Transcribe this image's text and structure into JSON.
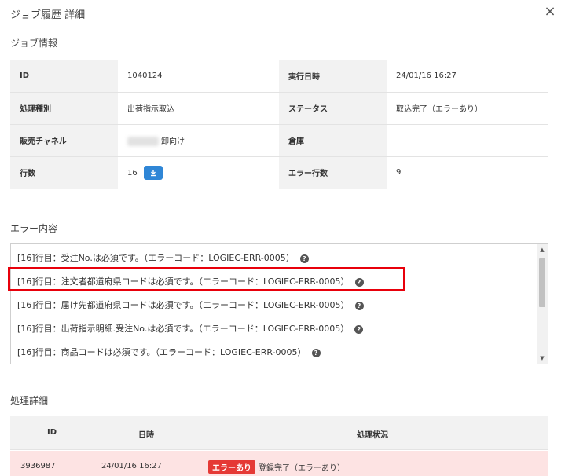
{
  "modal": {
    "title": "ジョブ履歴 詳細",
    "close_label": "×"
  },
  "job_info": {
    "title": "ジョブ情報",
    "rows": [
      {
        "l1": "ID",
        "v1": "1040124",
        "l2": "実行日時",
        "v2": "24/01/16 16:27"
      },
      {
        "l1": "処理種別",
        "v1": "出荷指示取込",
        "l2": "ステータス",
        "v2": "取込完了（エラーあり）"
      },
      {
        "l1": "販売チャネル",
        "v1": "卸向け",
        "l2": "倉庫",
        "v2": ""
      },
      {
        "l1": "行数",
        "v1": "16",
        "l2": "エラー行数",
        "v2": "9"
      }
    ]
  },
  "errors": {
    "title": "エラー内容",
    "items": [
      "[16]行目：受注No.は必須です。（エラーコード：LOGIEC-ERR-0005）",
      "[16]行目：注文者都道府県コードは必須です。（エラーコード：LOGIEC-ERR-0005）",
      "[16]行目：届け先都道府県コードは必須です。（エラーコード：LOGIEC-ERR-0005）",
      "[16]行目：出荷指示明細.受注No.は必須です。（エラーコード：LOGIEC-ERR-0005）",
      "[16]行目：商品コードは必須です。（エラーコード：LOGIEC-ERR-0005）"
    ]
  },
  "processing": {
    "title": "処理詳細",
    "headers": {
      "id": "ID",
      "datetime": "日時",
      "status": "処理状況"
    },
    "rows": [
      {
        "id": "3936987",
        "datetime": "24/01/16 16:27",
        "badge": "エラーあり",
        "status": "登録完了（エラーあり）"
      }
    ]
  },
  "colors": {
    "accent": "#2f86d6",
    "error": "#e53935",
    "highlight": "#e8000b",
    "error_row_bg": "#fde3e3"
  },
  "icons": {
    "close": "close-icon",
    "download": "download-icon",
    "help": "help-icon"
  }
}
